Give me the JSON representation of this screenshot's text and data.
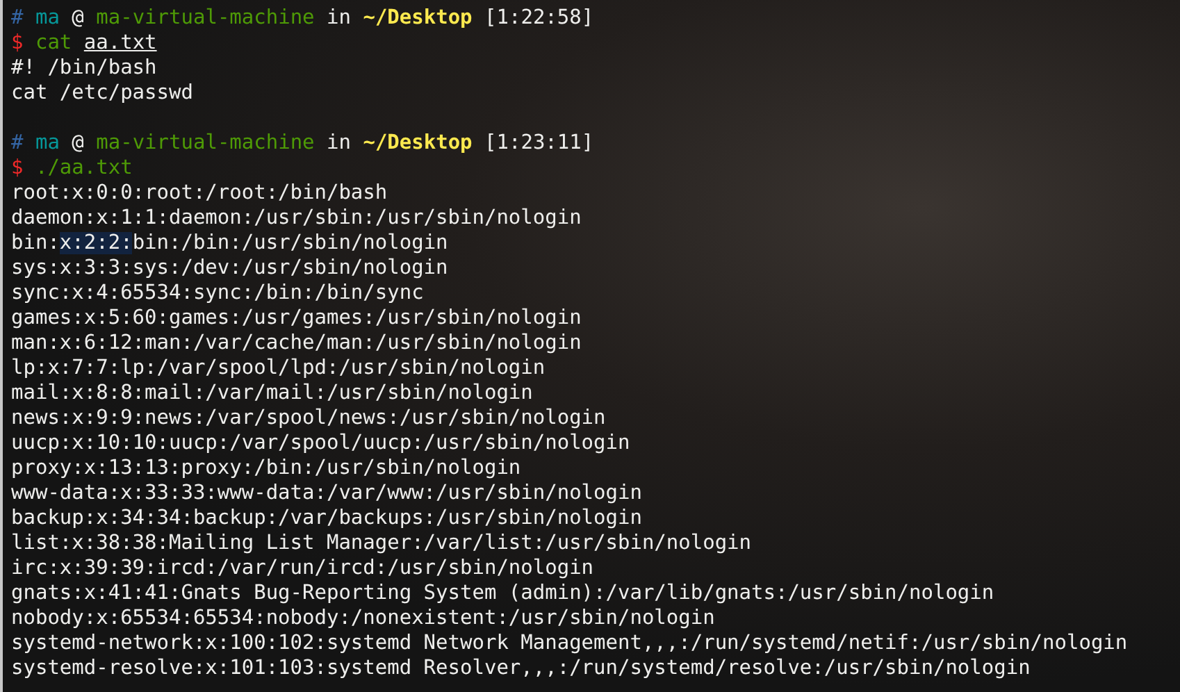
{
  "terminal": {
    "blocks": [
      {
        "prompt": [
          {
            "kind": "hash",
            "text": "#"
          },
          {
            "kind": "user",
            "text": "ma"
          },
          {
            "kind": "plain",
            "text": "@"
          },
          {
            "kind": "host",
            "text": "ma-virtual-machine"
          },
          {
            "kind": "plain",
            "text": "in"
          },
          {
            "kind": "path",
            "text": "~/Desktop"
          },
          {
            "kind": "plain",
            "text": "[1:22:58]"
          }
        ],
        "command": [
          {
            "kind": "sigil",
            "text": "$"
          },
          {
            "kind": "program",
            "text": "cat"
          },
          {
            "kind": "argument",
            "text": "aa.txt"
          }
        ],
        "output": [
          "#! /bin/bash",
          "cat /etc/passwd"
        ]
      },
      {
        "prompt": [
          {
            "kind": "hash",
            "text": "#"
          },
          {
            "kind": "user",
            "text": "ma"
          },
          {
            "kind": "plain",
            "text": "@"
          },
          {
            "kind": "host",
            "text": "ma-virtual-machine"
          },
          {
            "kind": "plain",
            "text": "in"
          },
          {
            "kind": "path",
            "text": "~/Desktop"
          },
          {
            "kind": "plain",
            "text": "[1:23:11]"
          }
        ],
        "command": [
          {
            "kind": "sigil",
            "text": "$"
          },
          {
            "kind": "program",
            "text": "./aa.txt"
          }
        ],
        "output": [
          "root:x:0:0:root:/root:/bin/bash",
          "daemon:x:1:1:daemon:/usr/sbin:/usr/sbin/nologin",
          {
            "segments": [
              {
                "text": "bin:",
                "selected": false
              },
              {
                "text": "x:2:2:",
                "selected": true
              },
              {
                "text": "bin:/bin:/usr/sbin/nologin",
                "selected": false
              }
            ]
          },
          "sys:x:3:3:sys:/dev:/usr/sbin/nologin",
          "sync:x:4:65534:sync:/bin:/bin/sync",
          "games:x:5:60:games:/usr/games:/usr/sbin/nologin",
          "man:x:6:12:man:/var/cache/man:/usr/sbin/nologin",
          "lp:x:7:7:lp:/var/spool/lpd:/usr/sbin/nologin",
          "mail:x:8:8:mail:/var/mail:/usr/sbin/nologin",
          "news:x:9:9:news:/var/spool/news:/usr/sbin/nologin",
          "uucp:x:10:10:uucp:/var/spool/uucp:/usr/sbin/nologin",
          "proxy:x:13:13:proxy:/bin:/usr/sbin/nologin",
          "www-data:x:33:33:www-data:/var/www:/usr/sbin/nologin",
          "backup:x:34:34:backup:/var/backups:/usr/sbin/nologin",
          "list:x:38:38:Mailing List Manager:/var/list:/usr/sbin/nologin",
          "irc:x:39:39:ircd:/var/run/ircd:/usr/sbin/nologin",
          "gnats:x:41:41:Gnats Bug-Reporting System (admin):/var/lib/gnats:/usr/sbin/nologin",
          "nobody:x:65534:65534:nobody:/nonexistent:/usr/sbin/nologin",
          "systemd-network:x:100:102:systemd Network Management,,,:/run/systemd/netif:/usr/sbin/nologin",
          "systemd-resolve:x:101:103:systemd Resolver,,,:/run/systemd/resolve:/usr/sbin/nologin"
        ]
      }
    ]
  }
}
